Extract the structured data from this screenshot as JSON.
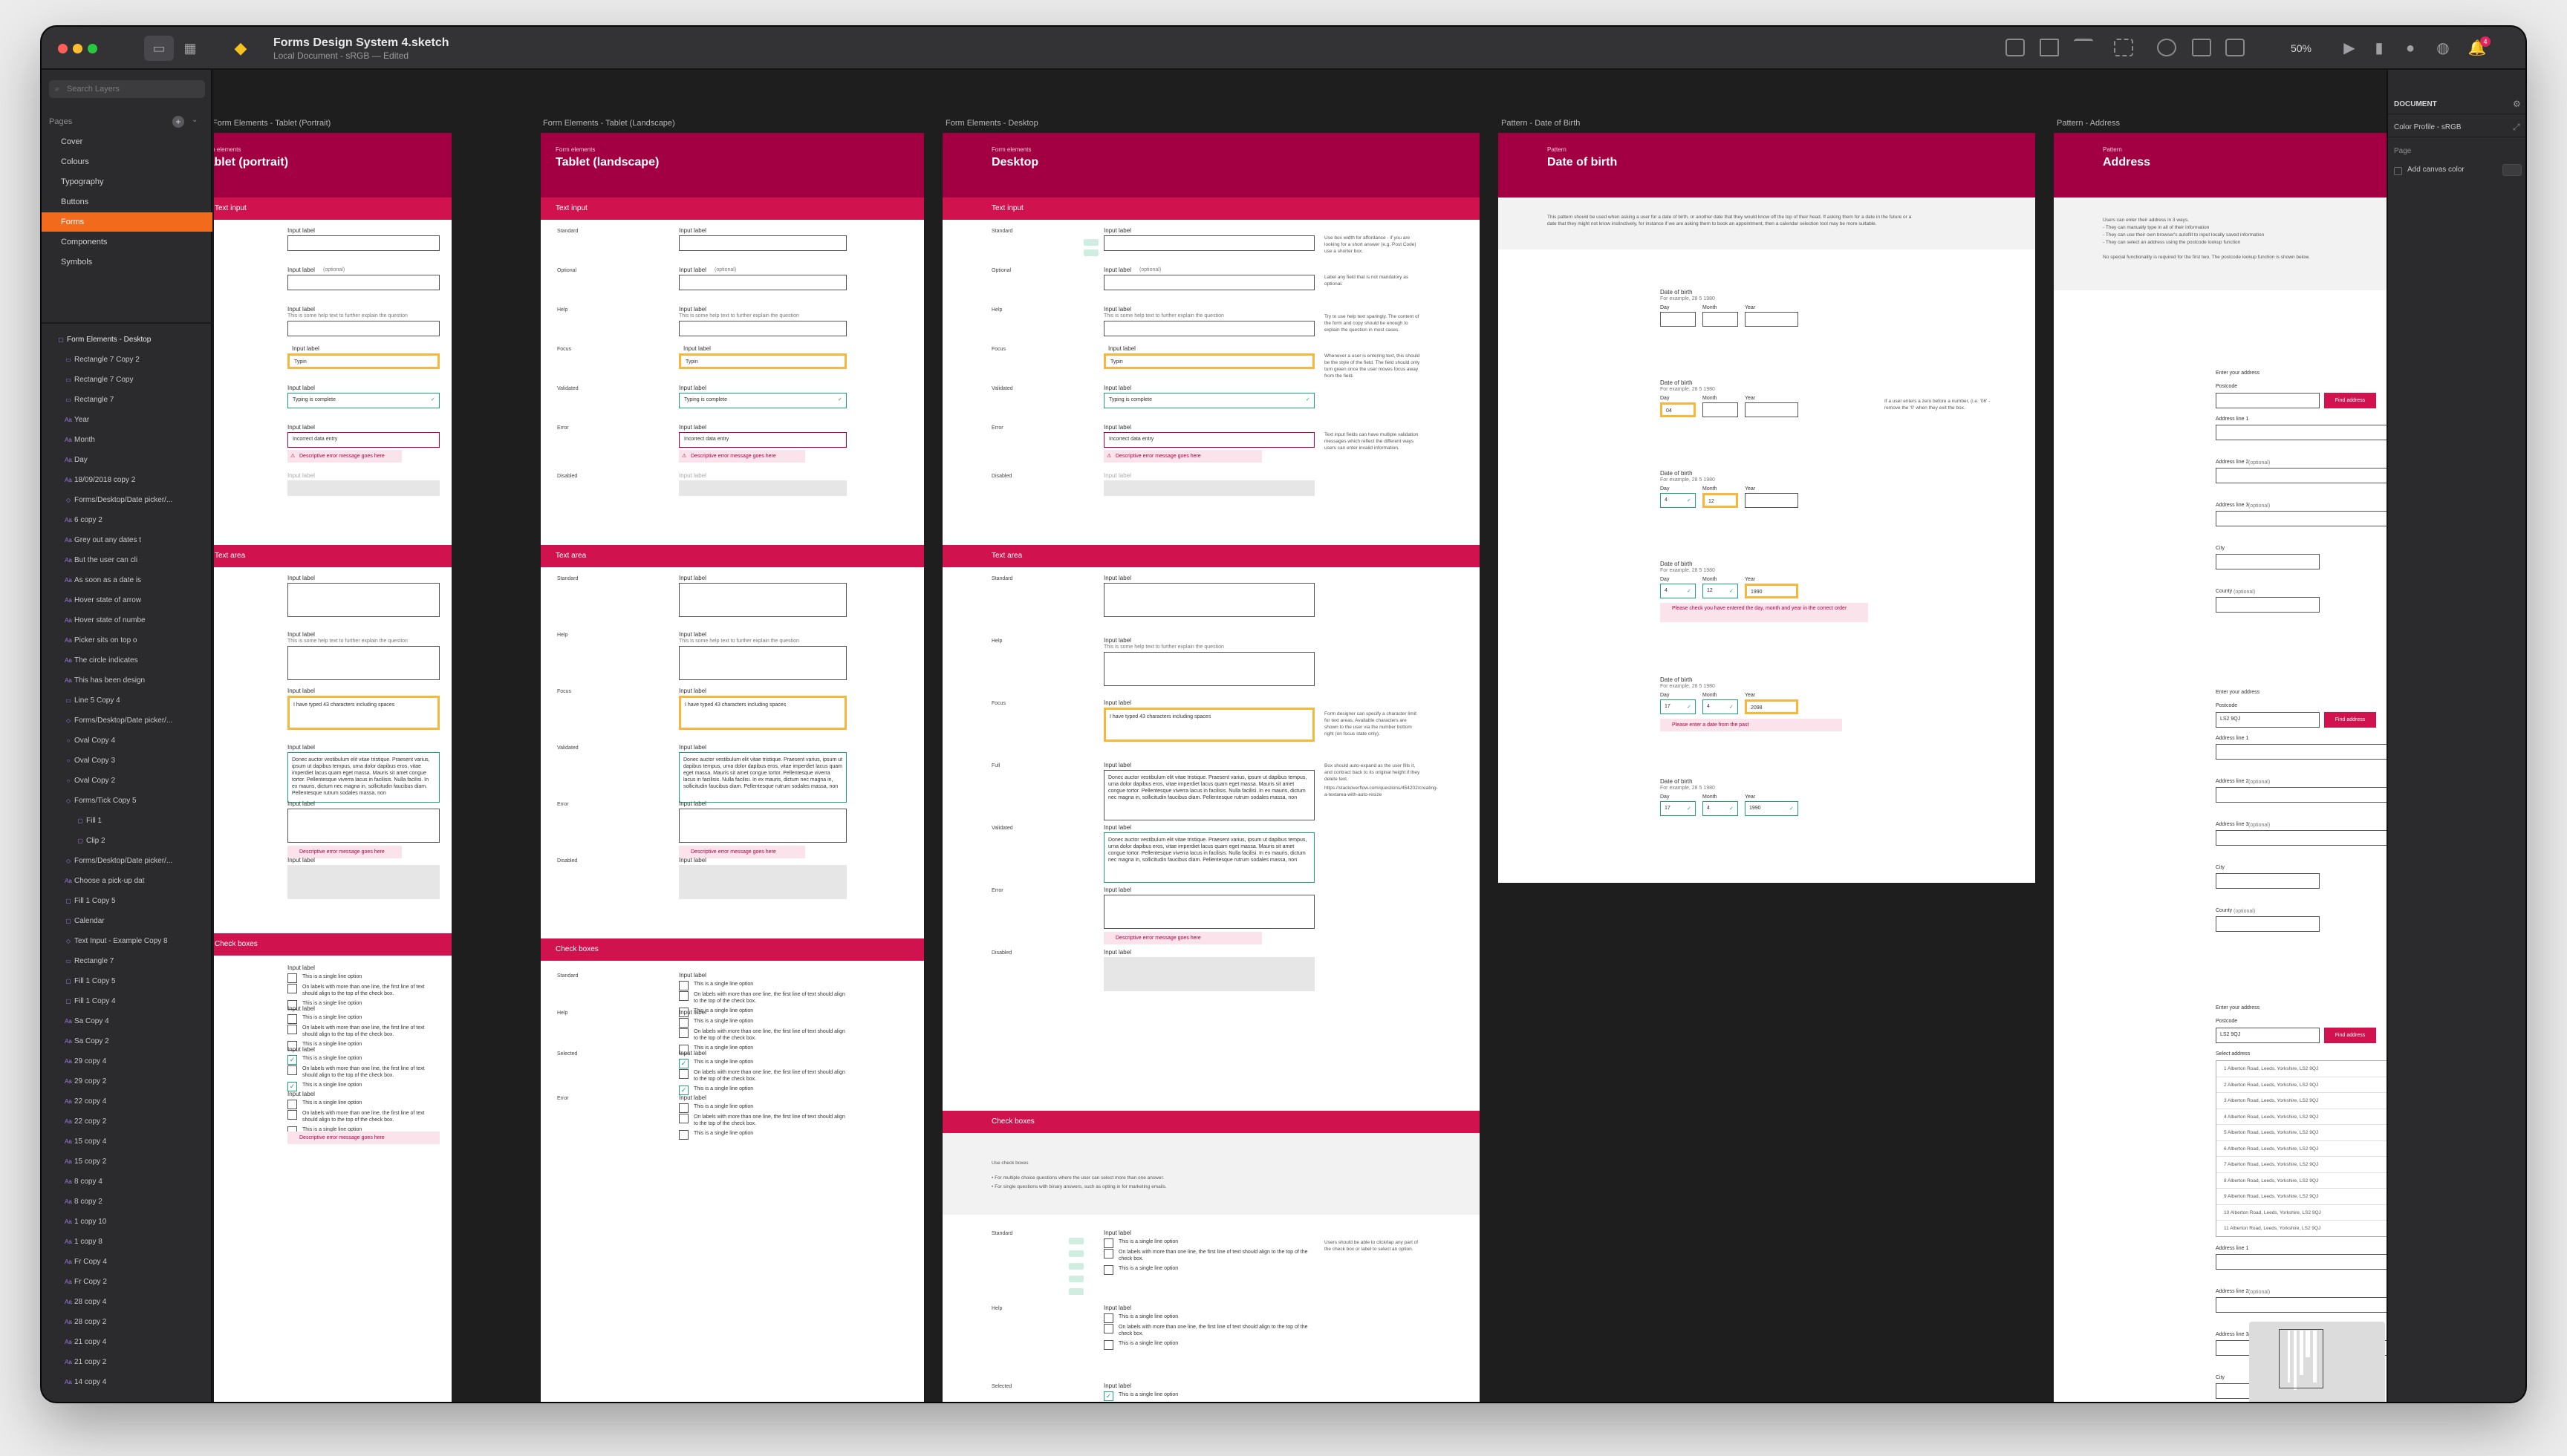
{
  "window": {
    "title": "Forms Design System 4.sketch",
    "subtitle": "Local Document - sRGB — Edited",
    "zoom": "50%",
    "notification_count": "4"
  },
  "sidebar": {
    "search_placeholder": "Search Layers",
    "pages_header": "Pages",
    "pages": [
      "Cover",
      "Colours",
      "Typography",
      "Buttons",
      "Forms",
      "Components",
      "Symbols"
    ],
    "active_page": "Forms",
    "layers": [
      "Form Elements - Desktop",
      "Rectangle 7 Copy 2",
      "Rectangle 7 Copy",
      "Rectangle 7",
      "Year",
      "Month",
      "Day",
      "18/09/2018 copy 2",
      "Forms/Desktop/Date picker/...",
      "6 copy 2",
      "Grey out any dates t",
      "But the user can cli",
      "As soon as a date is",
      "Hover state of arrow",
      "Hover state of numbe",
      "Picker sits on top o",
      "The circle indicates",
      "This has been design",
      "Line 5 Copy 4",
      "Forms/Desktop/Date picker/...",
      "Oval Copy 4",
      "Oval Copy 3",
      "Oval Copy 2",
      "Forms/Tick Copy 5",
      "Fill 1",
      "Clip 2",
      "Forms/Desktop/Date picker/...",
      "Choose a pick-up dat",
      "Fill 1 Copy 5",
      "Calendar",
      "Text Input - Example Copy 8",
      "Rectangle 7",
      "Fill 1 Copy 5",
      "Fill 1 Copy 4",
      "Sa Copy 4",
      "Sa Copy 2",
      "29 copy 4",
      "29 copy 2",
      "22 copy 4",
      "22 copy 2",
      "15 copy 4",
      "15 copy 2",
      "8 copy 4",
      "8 copy 2",
      "1 copy 10",
      "1 copy 8",
      "Fr Copy 4",
      "Fr Copy 2",
      "28 copy 4",
      "28 copy 2",
      "21 copy 4",
      "21 copy 2",
      "14 copy 4"
    ]
  },
  "inspector": {
    "header": "DOCUMENT",
    "color_profile": "Color Profile - sRGB",
    "page_label": "Page",
    "canvas_color": "Add canvas color"
  },
  "artboards": {
    "portrait": {
      "label": "Form Elements - Tablet (Portrait)",
      "kicker": "Form elements",
      "title": "Tablet (portrait)"
    },
    "landscape": {
      "label": "Form Elements - Tablet (Landscape)",
      "kicker": "Form elements",
      "title": "Tablet (landscape)"
    },
    "desktop": {
      "label": "Form Elements - Desktop",
      "kicker": "Form elements",
      "title": "Desktop",
      "hints": [
        "Use box width for affordance - if you are looking for a short answer (e.g. Post Code) use a shorter box.",
        "Label any field that is not mandatory as optional.",
        "Try to use help text sparingly. The content of the form and copy should be enough to explain the question in most cases.",
        "Whenever a user is entering text, this should be the style of the field. The field should only turn green once the user moves focus away from the field.",
        "Text input fields can have multiple validation messages which reflect the different ways users can enter invalid information.",
        "Form designer can specify a character limit for text areas. Available characters are shown to the user via the number bottom right (on focus state only).",
        "Box should auto-expand as the user fills it, and contract back to its original height if they delete text.",
        "https://stackoverflow.com/questions/454202/creating-a-textarea-with-auto-resize",
        "Users should be able to click/tap any part of the check box or label to select an option."
      ],
      "checkbox_intro": "Use check boxes",
      "checkbox_bullets": [
        "• For multiple choice questions where the user can select more than one answer.",
        "• For single questions with binary answers, such as opting in for marketing emails."
      ]
    },
    "dob": {
      "label": "Pattern - Date of Birth",
      "kicker": "Pattern",
      "title": "Date of birth",
      "intro": "This pattern should be used when asking a user for a date of birth, or another date that they would know off the top of their head. If asking them for a date in the future or a date that they might not know instinctively, for instance if we are asking them to book an appointment, then a calendar selection tool may be more suitable.",
      "note": "If a user enters a zero before a number, (i.e. '06' - remove the '0' when they exit the box.",
      "question": "Date of birth",
      "example": "For example, 28 5 1980",
      "day": "Day",
      "month": "Month",
      "year": "Year",
      "errors": [
        "Please check you have entered the day, month and year in the correct order",
        "Please enter a date from the past"
      ]
    },
    "address": {
      "label": "Pattern - Address",
      "kicker": "Pattern",
      "title": "Address",
      "intro": [
        "Users can enter their address in 3 ways.",
        "- They can manually type in all of their information",
        "- They can use their own browser's autofill to input locally saved information",
        "- They can select an address using the postcode lookup function",
        "No special functionality is required for the first two. The postcode lookup function is shown below."
      ],
      "heading": "Enter your address",
      "postcode": "Postcode",
      "postcode_value": "LS2 9QJ",
      "find": "Find address",
      "line1": "Address line 1",
      "line2": "Address line 2",
      "line3": "Address line 3",
      "optional": "(optional)",
      "city": "City",
      "county": "County",
      "select": "Select address",
      "addresses": [
        "1 Alberton Road, Leeds, Yorkshire, LS2 9QJ",
        "2 Alberton Road, Leeds, Yorkshire, LS2 9QJ",
        "3 Alberton Road, Leeds, Yorkshire, LS2 9QJ",
        "4 Alberton Road, Leeds, Yorkshire, LS2 9QJ",
        "5 Alberton Road, Leeds, Yorkshire, LS2 9QJ",
        "6 Alberton Road, Leeds, Yorkshire, LS2 9QJ",
        "7 Alberton Road, Leeds, Yorkshire, LS2 9QJ",
        "8 Alberton Road, Leeds, Yorkshire, LS2 9QJ",
        "9 Alberton Road, Leeds, Yorkshire, LS2 9QJ",
        "10 Alberton Road, Leeds, Yorkshire, LS2 9QJ",
        "11 Alberton Road, Leeds, Yorkshire, LS2 9QJ"
      ]
    }
  },
  "form": {
    "sections": {
      "text_input": "Text input",
      "text_area": "Text area",
      "check_boxes": "Check boxes"
    },
    "states": {
      "standard": "Standard",
      "optional": "Optional",
      "help": "Help",
      "focus": "Focus",
      "validated": "Validated",
      "error": "Error",
      "disabled": "Disabled",
      "full": "Full",
      "selected": "Selected"
    },
    "input_label": "Input label",
    "optional_suffix": "(optional)",
    "help_text": "This is some help text to further explain the question",
    "typing": "Typin",
    "complete": "Typing is complete",
    "incorrect": "Incorrect data entry",
    "error_msg": "Descriptive error message goes here",
    "focus_ta": "I have typed 43 characters including spaces",
    "lorem": "Donec auctor vestibulum elit vitae tristique. Praesent varius, ipsum ut dapibus tempus, urna dolor dapibus eros, vitae imperdiet lacus quam eget massa. Mauris sit amet congue tortor. Pellentesque viverra lacus in facilisis. Nulla facilisi. In ex mauris, dictum nec magna in, sollicitudin faucibus diam. Pellentesque rutrum sodales massa, non",
    "cb_single": "This is a single line option",
    "cb_multi": "On labels with more than one line, the first line of text should align to the top of the check box."
  }
}
